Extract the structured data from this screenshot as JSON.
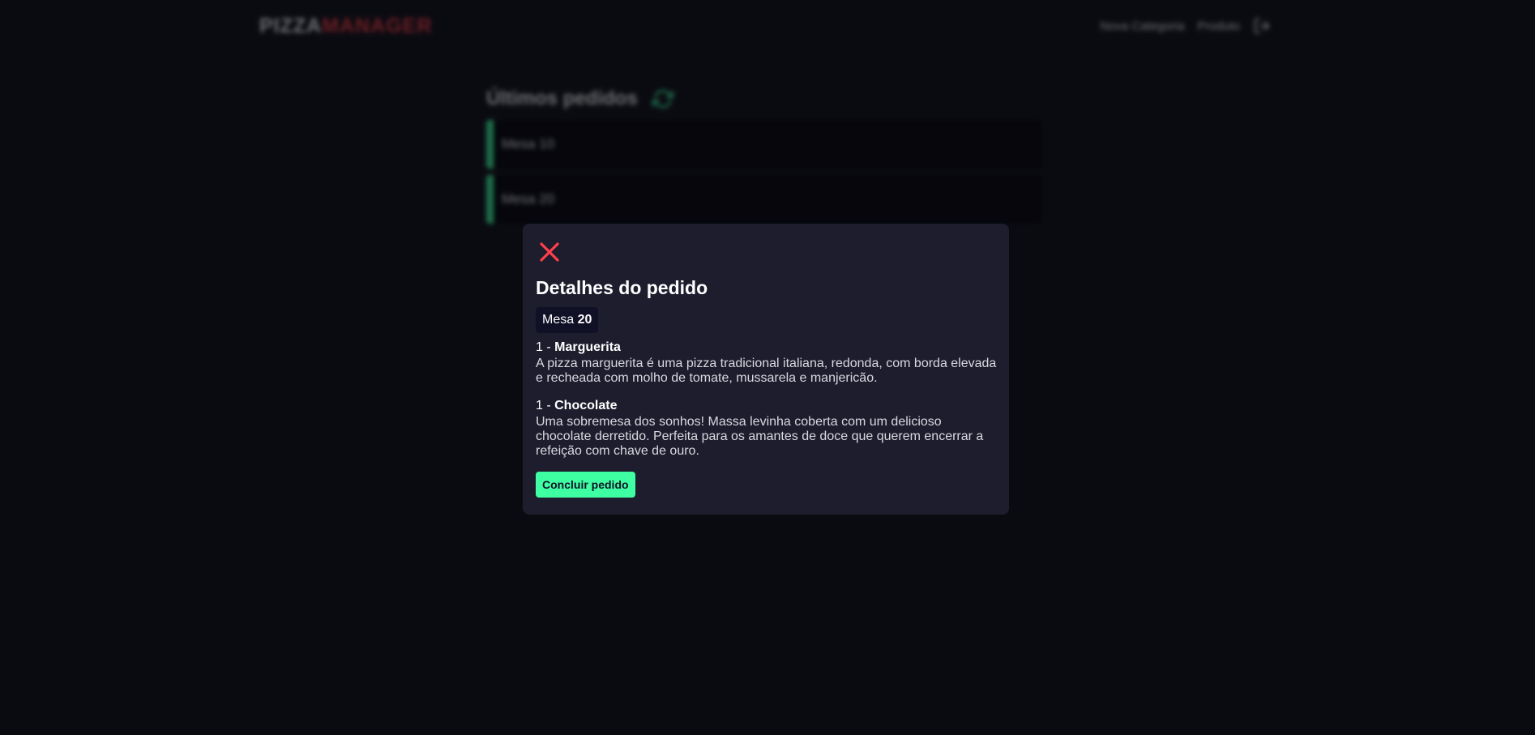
{
  "header": {
    "logo_part1": "PIZZA",
    "logo_part2": "MANAGER",
    "nav": [
      {
        "label": "Nova Categoria"
      },
      {
        "label": "Produto"
      }
    ],
    "logout_icon": "logout-icon"
  },
  "orders": {
    "title": "Últimos pedidos",
    "refresh_icon": "refresh-icon",
    "items": [
      {
        "label": "Mesa 10"
      },
      {
        "label": "Mesa 20"
      }
    ]
  },
  "modal": {
    "close_icon": "close-icon",
    "title": "Detalhes do pedido",
    "table_prefix": "Mesa",
    "table_number": "20",
    "items": [
      {
        "amount": "1",
        "separator": " - ",
        "name": "Marguerita",
        "description": "A pizza marguerita é uma pizza tradicional italiana, redonda, com borda elevada e recheada com molho de tomate, mussarela e manjericão."
      },
      {
        "amount": "1",
        "separator": " - ",
        "name": "Chocolate",
        "description": "Uma sobremesa dos sonhos! Massa levinha coberta com um delicioso chocolate derretido. Perfeita para os amantes de doce que querem encerrar a refeição com chave de ouro."
      }
    ],
    "finish_label": "Concluir pedido"
  },
  "colors": {
    "background": "#0d0e16",
    "modal": "#1d1d2e",
    "accent_green": "#3fffa3",
    "accent_red": "#ff3f4b"
  }
}
